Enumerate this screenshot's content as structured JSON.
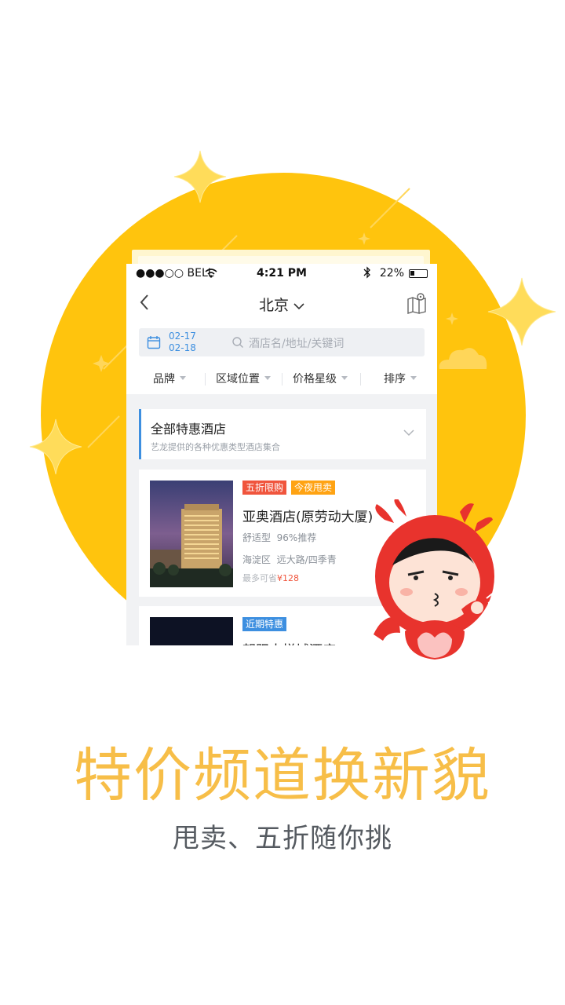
{
  "colors": {
    "yellow": "#ffc40d",
    "accent_blue": "#3d8fe0",
    "headline": "#f7be48",
    "tag_red": "#f0553d",
    "tag_orange": "#ffa313",
    "tag_blue": "#3d8fe0"
  },
  "statusbar": {
    "carrier": "●●●○○ BELL",
    "time": "4:21 PM",
    "battery": "22%"
  },
  "navbar": {
    "city": "北京",
    "back_icon": "chevron-left-icon",
    "map_icon": "map-pin-icon"
  },
  "search": {
    "checkin": "02-17",
    "checkout": "02-18",
    "placeholder": "酒店名/地址/关键词"
  },
  "filters": [
    "品牌",
    "区域位置",
    "价格星级",
    "排序"
  ],
  "promo": {
    "title": "全部特惠酒店",
    "subtitle": "艺龙提供的各种优惠类型酒店集合"
  },
  "hotels": [
    {
      "tags": [
        "五折限购",
        "今夜甩卖"
      ],
      "name": "亚奥酒店(原劳动大厦)",
      "type": "舒适型",
      "recommend": "96%推荐",
      "district": "海淀区",
      "area": "远大路/四季青",
      "save_label": "最多可省",
      "save_amount": "¥128"
    },
    {
      "tags": [
        "近期特惠"
      ],
      "name": "朝阳大悦城酒店"
    }
  ],
  "headline": "特价频道换新貌",
  "subline": "甩卖、五折随你挑"
}
